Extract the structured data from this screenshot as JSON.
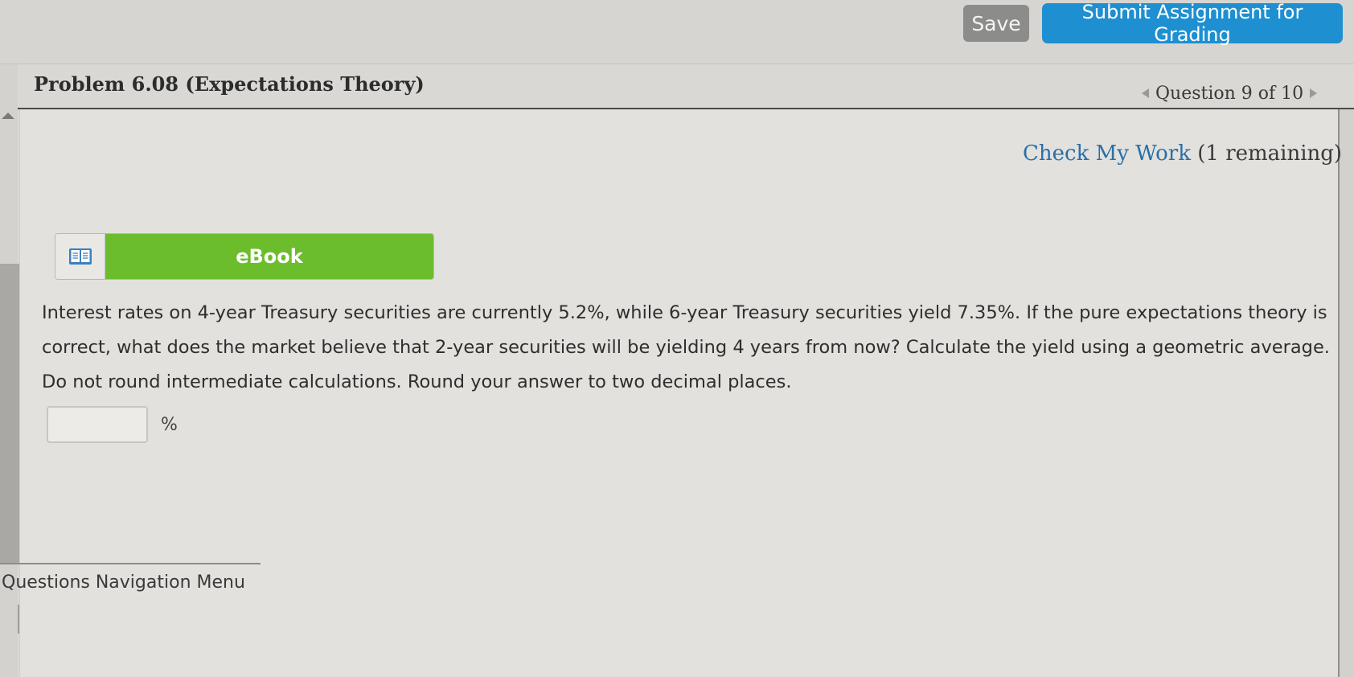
{
  "toolbar": {
    "save_label": "Save",
    "submit_label": "Submit Assignment for Grading"
  },
  "header": {
    "problem_title": "Problem 6.08 (Expectations Theory)",
    "question_nav": "Question 9 of 10"
  },
  "check_work": {
    "link_label": "Check My Work",
    "remaining": "(1 remaining)"
  },
  "ebook": {
    "label": "eBook",
    "icon": "book-icon"
  },
  "question": {
    "text": "Interest rates on 4-year Treasury securities are currently 5.2%, while 6-year Treasury securities yield 7.35%. If the pure expectations theory is correct, what does the market believe that 2-year securities will be yielding 4 years from now? Calculate the yield using a geometric average. Do not round intermediate calculations. Round your answer to two decimal places.",
    "answer_value": "",
    "unit": "%"
  },
  "nav_menu": {
    "label": "Questions Navigation Menu"
  },
  "colors": {
    "submit_blue": "#1e8fd0",
    "ebook_green": "#6bbd2c",
    "save_gray": "#8c8c8a",
    "link_blue": "#2a6fa8"
  }
}
